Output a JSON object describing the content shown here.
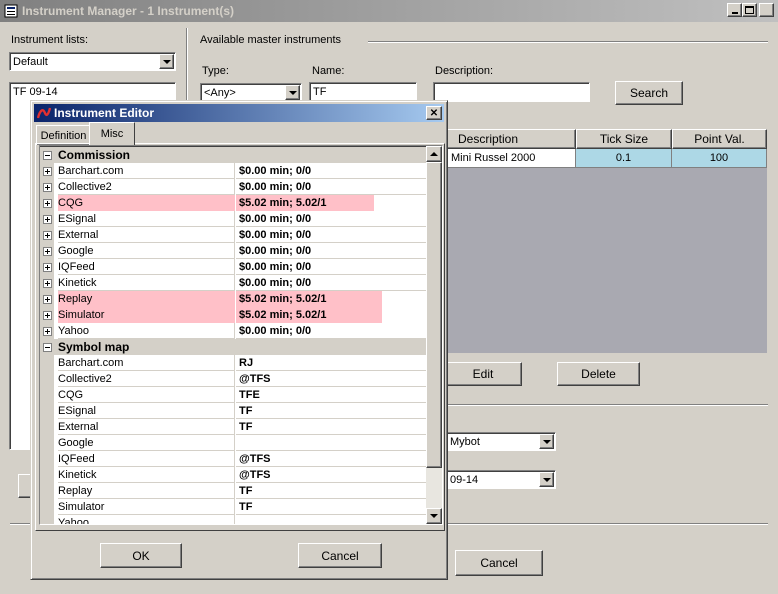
{
  "window": {
    "title": "Instrument Manager - 1 Instrument(s)"
  },
  "left": {
    "lists_label": "Instrument lists:",
    "list_selected": "Default",
    "list_items": [
      "TF 09-14"
    ]
  },
  "master": {
    "group_label": "Available master instruments",
    "type_label": "Type:",
    "type_value": "<Any>",
    "name_label": "Name:",
    "name_value": "TF",
    "desc_label": "Description:",
    "desc_value": "",
    "search_button": "Search",
    "columns": [
      "Description",
      "Tick Size",
      "Point Val."
    ],
    "rows": [
      {
        "description": "Mini Russel 2000",
        "tick_size": "0.1",
        "point_value": "100"
      }
    ],
    "edit_button": "Edit",
    "delete_button": "Delete"
  },
  "lower": {
    "combo1_value": "Mybot",
    "combo2_value": "09-14",
    "cancel_button": "Cancel"
  },
  "dialog": {
    "title": "Instrument Editor",
    "tabs": [
      "Definition",
      "Misc"
    ],
    "active_tab": "Misc",
    "commission_label": "Commission",
    "commission": [
      {
        "name": "Barchart.com",
        "value": "$0.00 min;  0/0",
        "highlight": false
      },
      {
        "name": "Collective2",
        "value": "$0.00 min;  0/0",
        "highlight": false
      },
      {
        "name": "CQG",
        "value": "$5.02 min; 5.02/1",
        "highlight": true
      },
      {
        "name": "ESignal",
        "value": "$0.00 min;  0/0",
        "highlight": false
      },
      {
        "name": "External",
        "value": "$0.00 min;  0/0",
        "highlight": false
      },
      {
        "name": "Google",
        "value": "$0.00 min;  0/0",
        "highlight": false
      },
      {
        "name": "IQFeed",
        "value": "$0.00 min;  0/0",
        "highlight": false
      },
      {
        "name": "Kinetick",
        "value": "$0.00 min;  0/0",
        "highlight": false
      },
      {
        "name": "Replay",
        "value": "$5.02 min; 5.02/1",
        "highlight": true
      },
      {
        "name": "Simulator",
        "value": "$5.02 min; 5.02/1",
        "highlight": true
      },
      {
        "name": "Yahoo",
        "value": "$0.00 min;  0/0",
        "highlight": false
      }
    ],
    "symbol_map_label": "Symbol map",
    "symbol_map": [
      {
        "name": "Barchart.com",
        "value": "RJ"
      },
      {
        "name": "Collective2",
        "value": "@TFS"
      },
      {
        "name": "CQG",
        "value": "TFE"
      },
      {
        "name": "ESignal",
        "value": "TF"
      },
      {
        "name": "External",
        "value": "TF"
      },
      {
        "name": "Google",
        "value": ""
      },
      {
        "name": "IQFeed",
        "value": "@TFS"
      },
      {
        "name": "Kinetick",
        "value": "@TFS"
      },
      {
        "name": "Replay",
        "value": "TF"
      },
      {
        "name": "Simulator",
        "value": "TF"
      },
      {
        "name": "Yahoo",
        "value": ""
      }
    ],
    "ok_button": "OK",
    "cancel_button": "Cancel"
  },
  "colors": {
    "selected_cell": "#add8e6",
    "highlight_row": "#ffc0c8",
    "dialog_title": "#0a246a"
  }
}
